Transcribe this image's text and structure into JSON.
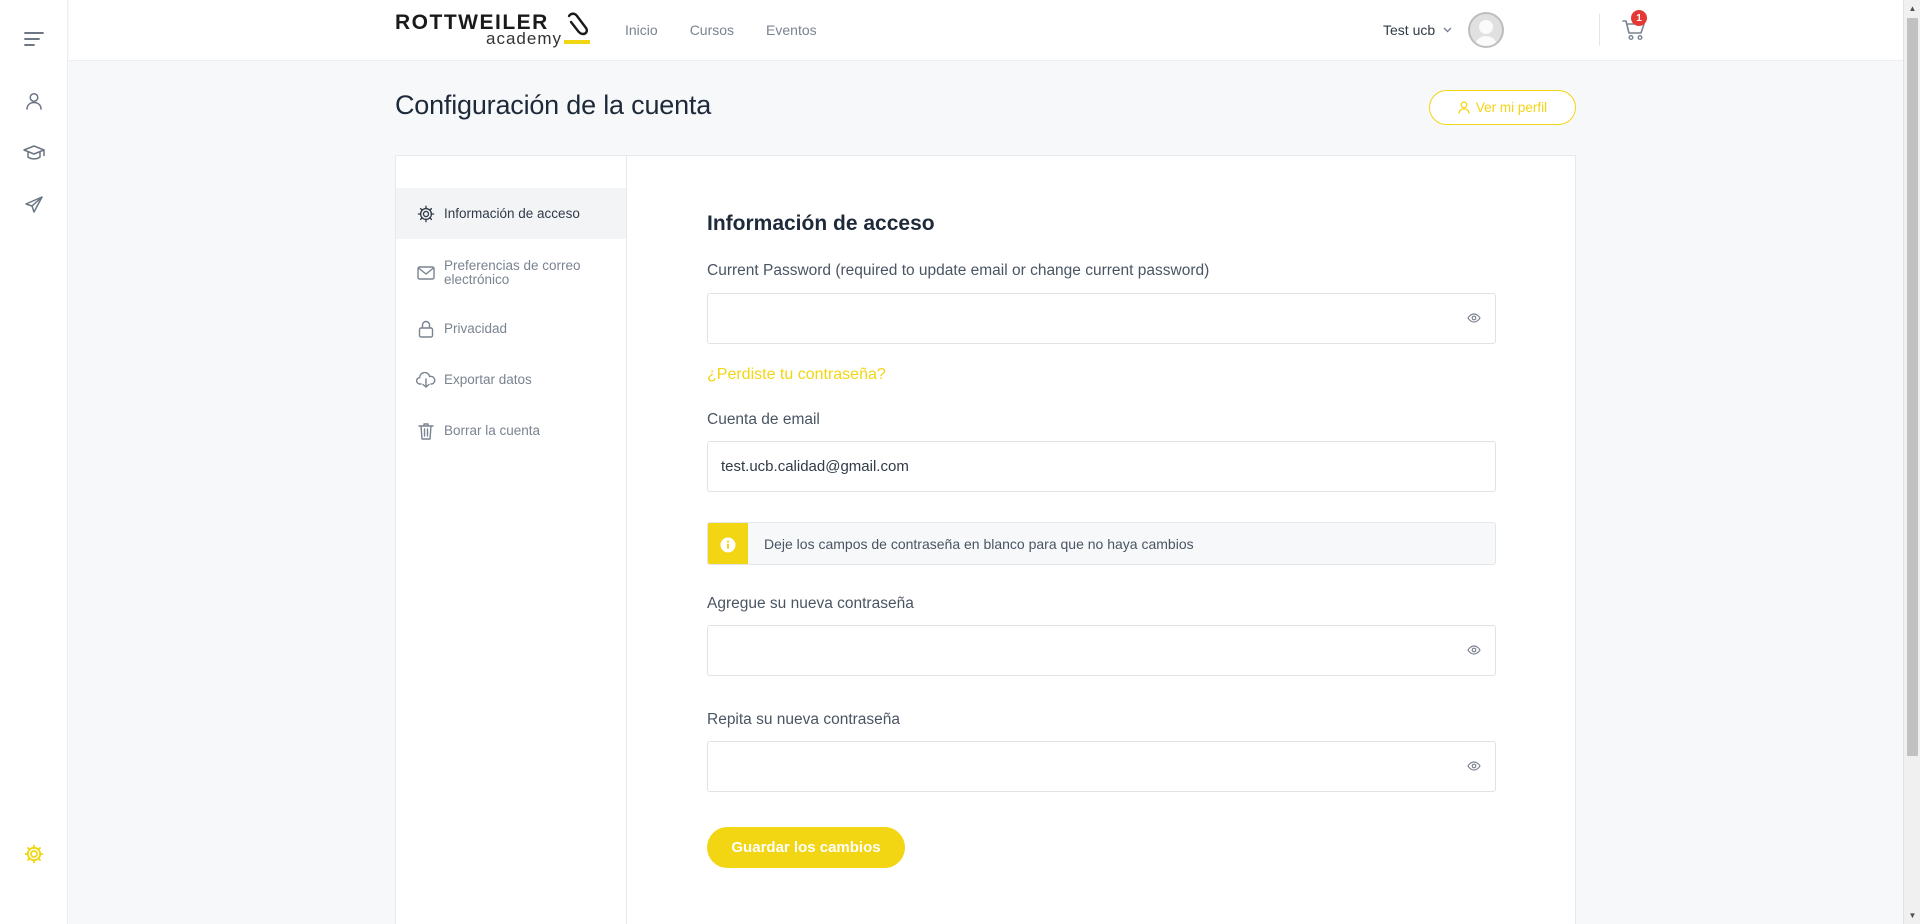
{
  "rail": {
    "items": [
      {
        "icon": "menu-icon"
      },
      {
        "icon": "user-icon"
      },
      {
        "icon": "graduation-cap-icon"
      },
      {
        "icon": "paper-plane-icon"
      }
    ],
    "settings_icon": "gear-icon"
  },
  "header": {
    "logo": {
      "word1": "ROTTWEILER",
      "word2": "academy"
    },
    "nav": [
      "Inicio",
      "Cursos",
      "Eventos"
    ],
    "user_name": "Test ucb",
    "cart_count": "1"
  },
  "page": {
    "title": "Configuración de la cuenta",
    "profile_button": "Ver mi perfil"
  },
  "sidebar": {
    "items": [
      {
        "label": "Información de acceso",
        "icon": "gear-icon",
        "active": true
      },
      {
        "label": "Preferencias de correo electrónico",
        "icon": "mail-icon",
        "active": false
      },
      {
        "label": "Privacidad",
        "icon": "lock-icon",
        "active": false
      },
      {
        "label": "Exportar datos",
        "icon": "cloud-download-icon",
        "active": false
      },
      {
        "label": "Borrar la cuenta",
        "icon": "trash-icon",
        "active": false
      }
    ]
  },
  "form": {
    "section_title": "Información de acceso",
    "current_password_label": "Current Password (required to update email or change current password)",
    "current_password_value": "",
    "forgot_link": "¿Perdiste tu contraseña?",
    "email_label": "Cuenta de email",
    "email_value": "test.ucb.calidad@gmail.com",
    "notice": "Deje los campos de contraseña en blanco para que no haya cambios",
    "new_password_label": "Agregue su nueva contraseña",
    "new_password_value": "",
    "repeat_password_label": "Repita su nueva contraseña",
    "repeat_password_value": "",
    "save_button": "Guardar los cambios"
  },
  "colors": {
    "accent": "#f2d513",
    "badge": "#e53935",
    "text": "#303b47",
    "muted": "#7a8390"
  }
}
